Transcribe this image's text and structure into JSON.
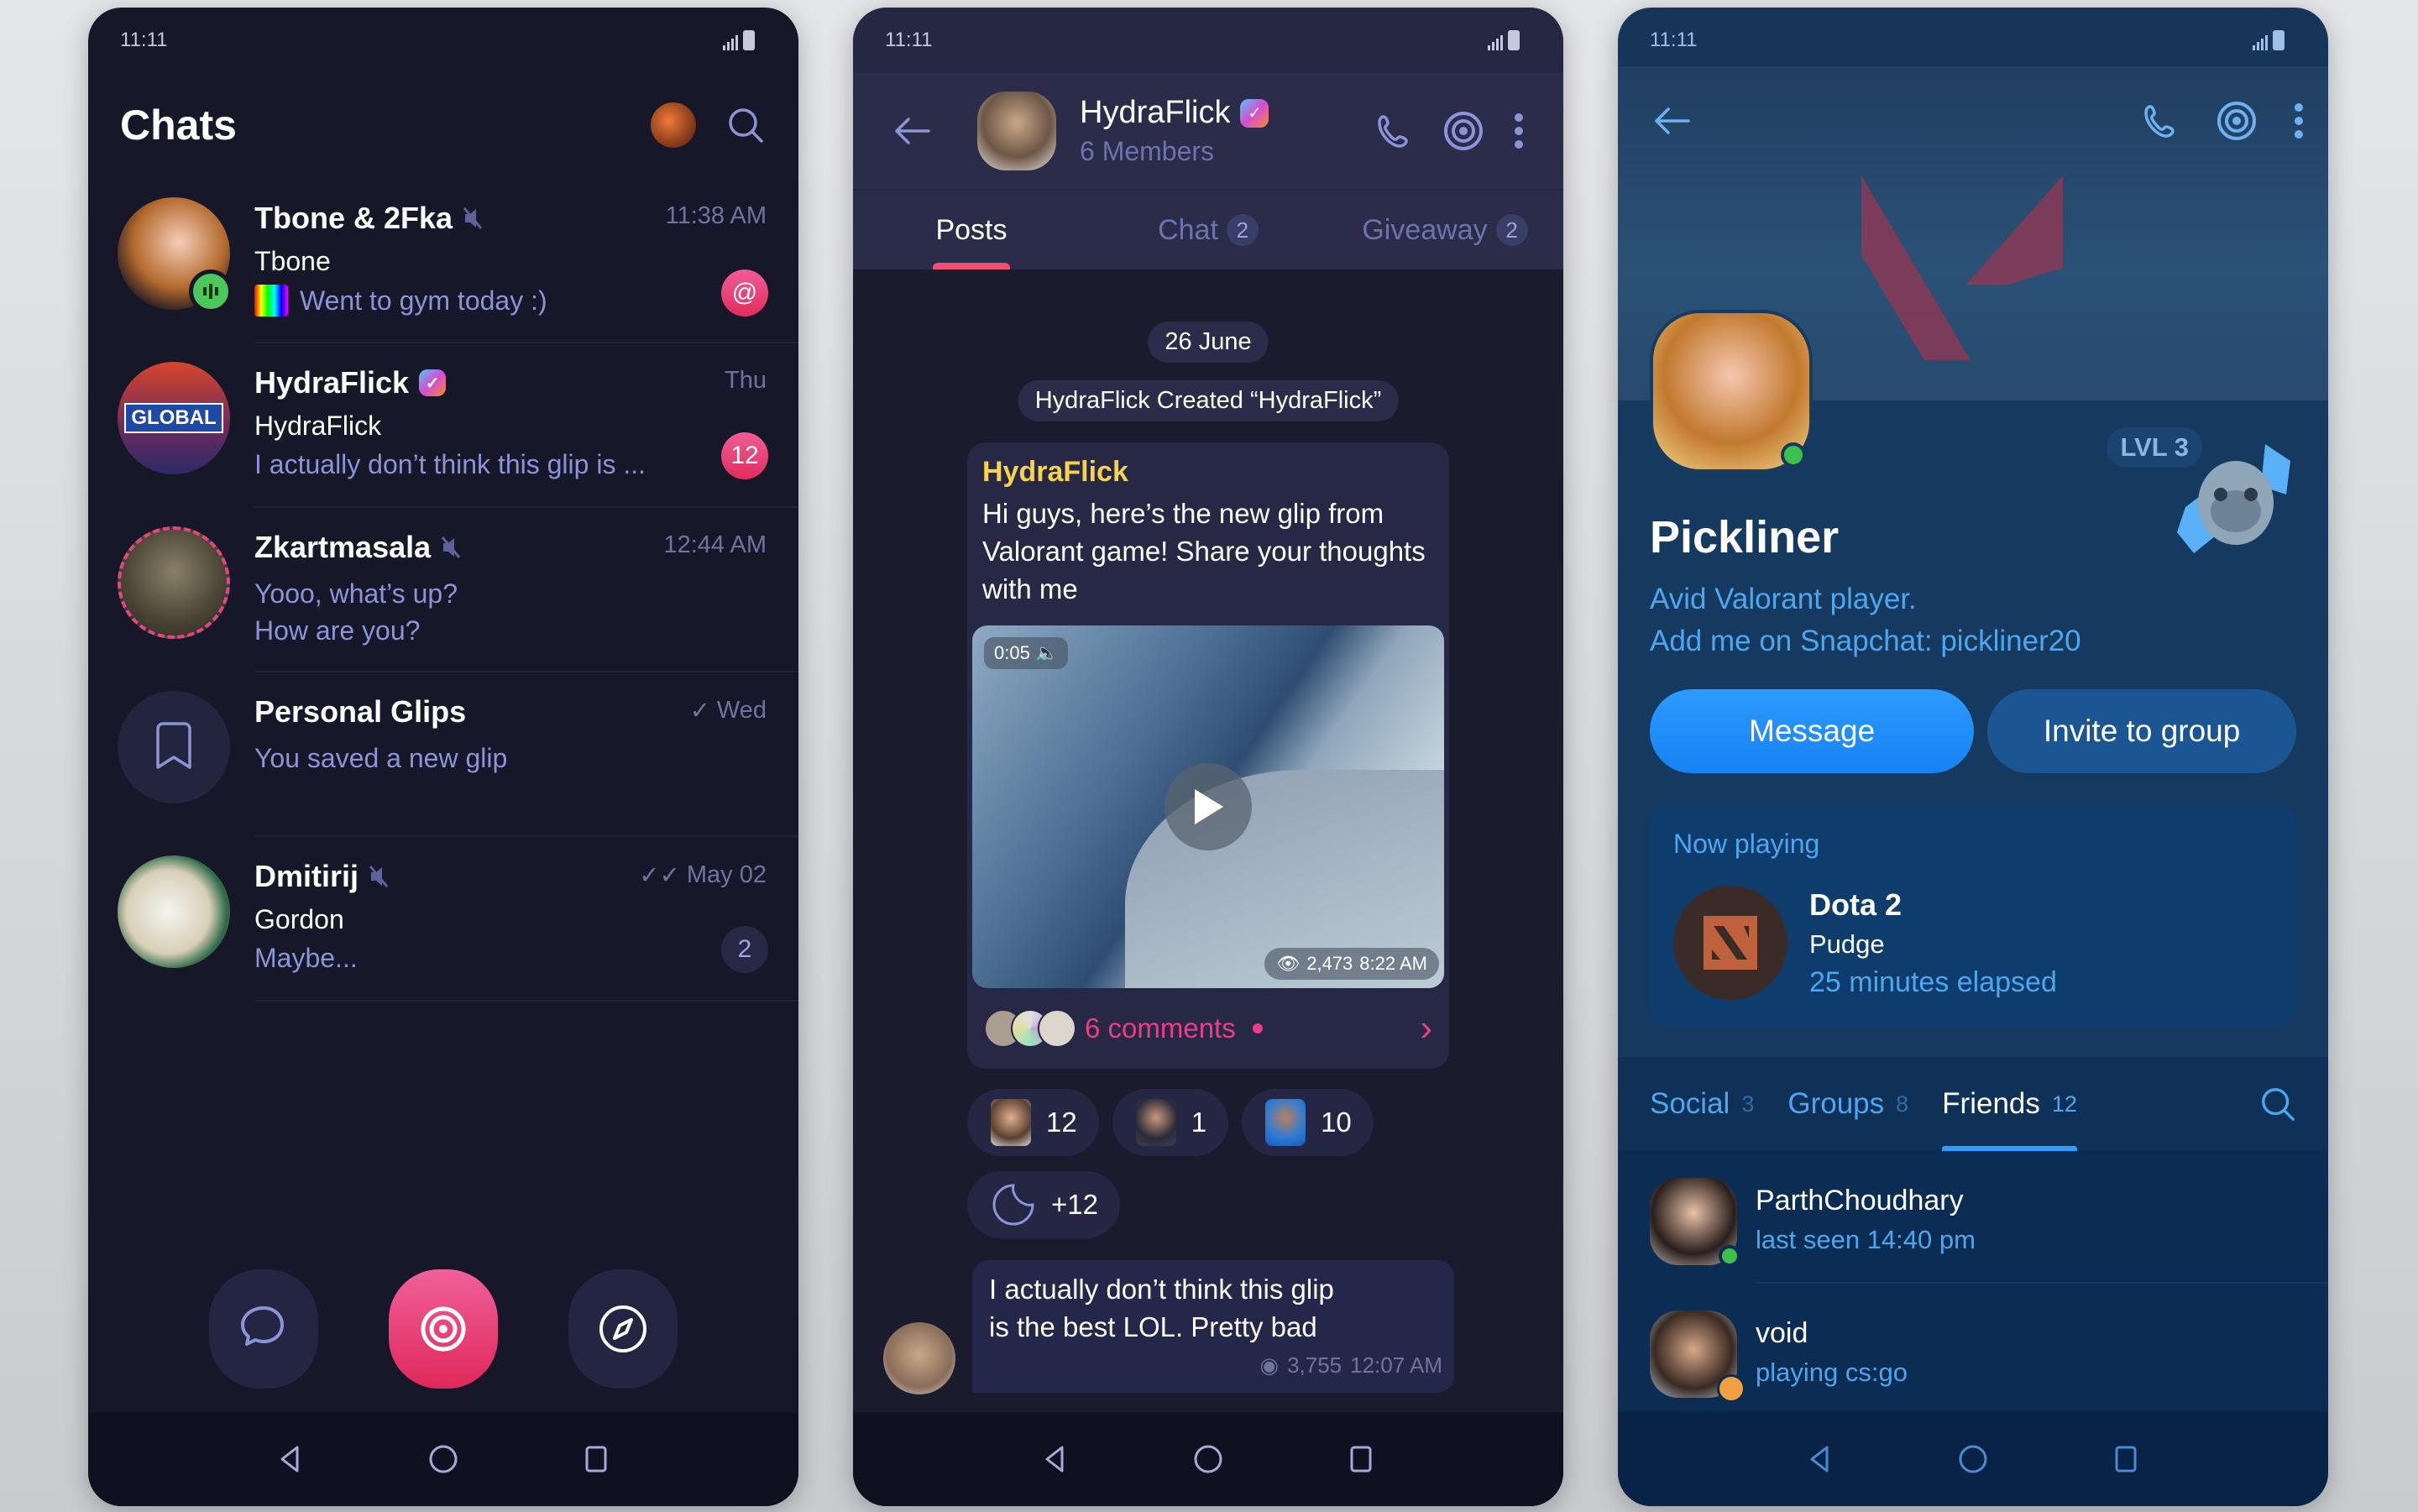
{
  "status_bar": {
    "time": "11:11"
  },
  "chats_screen": {
    "title": "Chats",
    "chats": [
      {
        "name": "Tbone & 2Fka",
        "muted": true,
        "time": "11:38 AM",
        "sender": "Tbone",
        "preview": "Went to gym today :)",
        "badge": "@",
        "badge_color": "#e83d73",
        "status_icon": "voice-chat-indicator"
      },
      {
        "name": "HydraFlick",
        "verified": true,
        "time": "Thu",
        "sender": "HydraFlick",
        "preview": "I actually don’t think this glip is ...",
        "badge": "12",
        "badge_color": "#e83d73"
      },
      {
        "name": "Zkartmasala",
        "muted": true,
        "time": "12:44 AM",
        "preview_line1": "Yooo, what’s up?",
        "preview_line2": "How are you?",
        "story_ring": true
      },
      {
        "name": "Personal Glips",
        "time": "Wed",
        "read": "single-check",
        "preview": "You saved a new glip",
        "icon": "bookmark-icon"
      },
      {
        "name": "Dmitirij",
        "muted": true,
        "time": "May 02",
        "read": "double-check",
        "sender": "Gordon",
        "preview": "Maybe...",
        "badge": "2",
        "badge_color": "#2a2c4a"
      }
    ],
    "bottom_actions": [
      "chats-icon",
      "glips-icon",
      "explore-icon"
    ]
  },
  "group_screen": {
    "name": "HydraFlick",
    "verified": true,
    "members": "6 Members",
    "tabs": [
      {
        "label": "Posts",
        "count": null,
        "active": true
      },
      {
        "label": "Chat",
        "count": "2",
        "active": false
      },
      {
        "label": "Giveaway",
        "count": "2",
        "active": false
      }
    ],
    "date_pill": "26 June",
    "system_msg": "HydraFlick Created “HydraFlick”",
    "post": {
      "author": "HydraFlick",
      "text": "Hi guys, here’s the new glip from Valorant game! Share your thoughts with me",
      "video_duration": "0:05",
      "views": "2,473",
      "time": "8:22 AM",
      "comments": "6 comments"
    },
    "reactions": [
      {
        "name": "sticker-reaction-1",
        "count": "12"
      },
      {
        "name": "sticker-reaction-2",
        "count": "1"
      },
      {
        "name": "sticker-reaction-3",
        "count": "10"
      }
    ],
    "more_reactions": "+12",
    "reply": {
      "text_line1": "I actually don’t think this glip",
      "text_line2": "is the best LOL. Pretty bad",
      "views": "3,755",
      "time": "12:07 AM"
    }
  },
  "profile_screen": {
    "name": "Pickliner",
    "level": "LVL 3",
    "bio_line1": "Avid Valorant player.",
    "bio_line2": "Add me on Snapchat: pickliner20",
    "message_button": "Message",
    "invite_button": "Invite to group",
    "now_playing": {
      "label": "Now playing",
      "game": "Dota 2",
      "hero": "Pudge",
      "elapsed": "25 minutes elapsed"
    },
    "tabs": [
      {
        "label": "Social",
        "count": "3",
        "active": false
      },
      {
        "label": "Groups",
        "count": "8",
        "active": false
      },
      {
        "label": "Friends",
        "count": "12",
        "active": true
      }
    ],
    "friends": [
      {
        "name": "ParthChoudhary",
        "status": "last seen 14:40 pm"
      },
      {
        "name": "void",
        "status": "playing cs:go"
      }
    ]
  },
  "colors": {
    "accent_pink": "#e83d73",
    "accent_blue": "#2d9bff",
    "author_yellow": "#f8d34a"
  }
}
